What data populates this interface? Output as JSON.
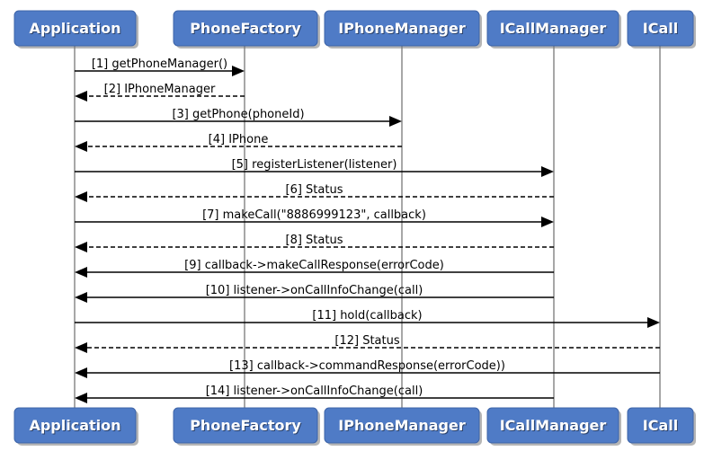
{
  "diagram": {
    "type": "sequence",
    "colors": {
      "participant_fill": "#4f7bc6",
      "participant_text": "#ffffff",
      "lifeline": "#8a8a8a",
      "message": "#000000"
    },
    "participants": [
      {
        "id": "app",
        "label": "Application"
      },
      {
        "id": "pf",
        "label": "PhoneFactory"
      },
      {
        "id": "ipm",
        "label": "IPhoneManager"
      },
      {
        "id": "icm",
        "label": "ICallManager"
      },
      {
        "id": "icall",
        "label": "ICall"
      }
    ],
    "messages": [
      {
        "n": 1,
        "from": "app",
        "to": "pf",
        "style": "sync",
        "label": "[1] getPhoneManager()"
      },
      {
        "n": 2,
        "from": "pf",
        "to": "app",
        "style": "return",
        "label": "[2] IPhoneManager"
      },
      {
        "n": 3,
        "from": "app",
        "to": "ipm",
        "style": "sync",
        "label": "[3] getPhone(phoneId)"
      },
      {
        "n": 4,
        "from": "ipm",
        "to": "app",
        "style": "return",
        "label": "[4] IPhone"
      },
      {
        "n": 5,
        "from": "app",
        "to": "icm",
        "style": "sync",
        "label": "[5] registerListener(listener)"
      },
      {
        "n": 6,
        "from": "icm",
        "to": "app",
        "style": "return",
        "label": "[6] Status"
      },
      {
        "n": 7,
        "from": "app",
        "to": "icm",
        "style": "sync",
        "label": "[7] makeCall(\"8886999123\", callback)"
      },
      {
        "n": 8,
        "from": "icm",
        "to": "app",
        "style": "return",
        "label": "[8] Status"
      },
      {
        "n": 9,
        "from": "icm",
        "to": "app",
        "style": "sync",
        "label": "[9] callback->makeCallResponse(errorCode)"
      },
      {
        "n": 10,
        "from": "icm",
        "to": "app",
        "style": "sync",
        "label": "[10] listener->onCallInfoChange(call)"
      },
      {
        "n": 11,
        "from": "app",
        "to": "icall",
        "style": "sync",
        "label": "[11] hold(callback)"
      },
      {
        "n": 12,
        "from": "icall",
        "to": "app",
        "style": "return",
        "label": "[12] Status"
      },
      {
        "n": 13,
        "from": "icall",
        "to": "app",
        "style": "sync",
        "label": "[13] callback->commandResponse(errorCode))"
      },
      {
        "n": 14,
        "from": "icm",
        "to": "app",
        "style": "sync",
        "label": "[14] listener->onCallInfoChange(call)"
      }
    ]
  }
}
